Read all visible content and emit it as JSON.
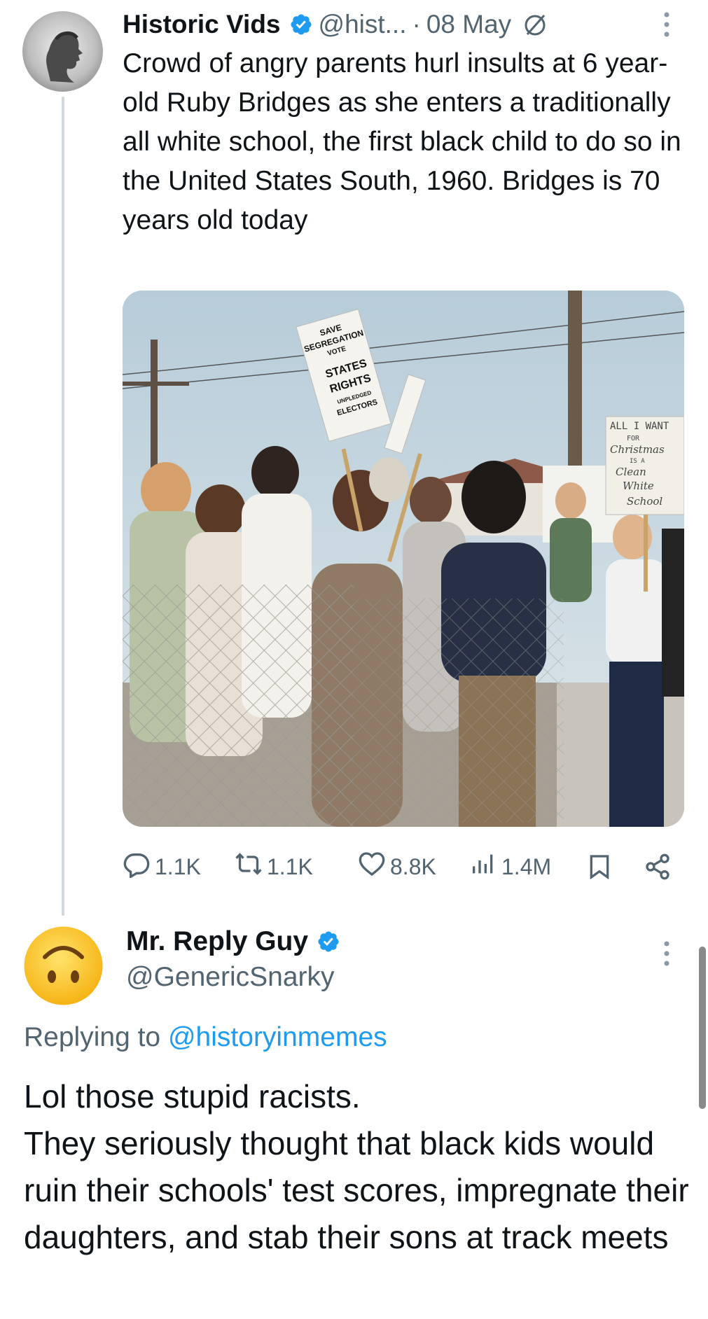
{
  "tweet": {
    "author_name": "Historic Vids",
    "handle": "@hist...",
    "separator": "·",
    "date": "08 May",
    "text": "Crowd of angry parents hurl insults at 6 year-old Ruby Bridges as she enters a traditionally all white school, the first black child to do so in the United States South, 1960. Bridges is 70 years old today",
    "media": {
      "sign_left": [
        "SAVE",
        "SEGREGATION",
        "VOTE",
        "STATES",
        "RIGHTS",
        "UNPLEDGED",
        "ELECTORS"
      ],
      "sign_right": [
        "ALL I WANT",
        "FOR",
        "Christmas",
        "IS A",
        "Clean",
        "White",
        "School"
      ]
    },
    "stats": {
      "replies": "1.1K",
      "reposts": "1.1K",
      "likes": "8.8K",
      "views": "1.4M"
    }
  },
  "reply": {
    "author_name": "Mr. Reply Guy",
    "handle": "@GenericSnarky",
    "replying_prefix": "Replying to",
    "replying_handle": "@historyinmemes",
    "lines": [
      "Lol those stupid racists.",
      "They seriously thought that black kids would ruin their schools' test scores, impregnate their daughters, and stab their sons at track meets"
    ]
  },
  "colors": {
    "accent": "#1d9bf0",
    "muted_text": "#536471",
    "thread_line": "#cfd9de"
  },
  "icons": [
    "verified-badge-icon",
    "grok-slash-icon",
    "more-options-icon",
    "reply-icon",
    "repost-icon",
    "like-icon",
    "views-icon",
    "bookmark-icon",
    "share-icon",
    "upside-down-face-emoji"
  ]
}
